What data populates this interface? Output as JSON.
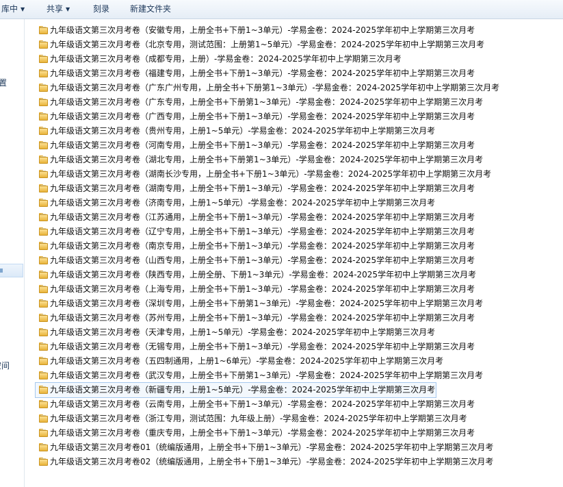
{
  "toolbar": {
    "library_label": "库中",
    "share_label": "共享",
    "burn_label": "刻录",
    "new_folder_label": "新建文件夹"
  },
  "nav": {
    "text_1": "置",
    "text_2": "空间"
  },
  "colors": {
    "toolbar_text": "#1e395b",
    "selection_border": "#a6c8ee",
    "folder_yellow": "#f2c75c"
  },
  "files": [
    "九年级语文第三次月考卷（安徽专用，上册全书+下册1~3单元）-学易金卷：2024-2025学年初中上学期第三次月考",
    "九年级语文第三次月考卷（北京专用，测试范围：上册第1~5单元）-学易金卷：2024-2025学年初中上学期第三次月考",
    "九年级语文第三次月考卷（成都专用，上册）-学易金卷：2024-2025学年初中上学期第三次月考",
    "九年级语文第三次月考卷（福建专用，上册全书+下册1~3单元）-学易金卷：2024-2025学年初中上学期第三次月考",
    "九年级语文第三次月考卷（广东广州专用，上册全书+下册第1~3单元）-学易金卷：2024-2025学年初中上学期第三次月考",
    "九年级语文第三次月考卷（广东专用，上册全书+下册第1~3单元）-学易金卷：2024-2025学年初中上学期第三次月考",
    "九年级语文第三次月考卷（广西专用，上册全书+下册1~3单元）-学易金卷：2024-2025学年初中上学期第三次月考",
    "九年级语文第三次月考卷（贵州专用，上册1~5单元）-学易金卷：2024-2025学年初中上学期第三次月考",
    "九年级语文第三次月考卷（河南专用，上册全书+下册1~3单元）-学易金卷：2024-2025学年初中上学期第三次月考",
    "九年级语文第三次月考卷（湖北专用，上册全书+下册第1~3单元）-学易金卷：2024-2025学年初中上学期第三次月考",
    "九年级语文第三次月考卷（湖南长沙专用，上册全书+下册1~3单元）-学易金卷：2024-2025学年初中上学期第三次月考",
    "九年级语文第三次月考卷（湖南专用，上册全书+下册1~3单元）-学易金卷：2024-2025学年初中上学期第三次月考",
    "九年级语文第三次月考卷（济南专用，上册1~5单元）-学易金卷：2024-2025学年初中上学期第三次月考",
    "九年级语文第三次月考卷（江苏通用，上册全书+下册1~3单元）-学易金卷：2024-2025学年初中上学期第三次月考",
    "九年级语文第三次月考卷（辽宁专用，上册全书+下册1~3单元）-学易金卷：2024-2025学年初中上学期第三次月考",
    "九年级语文第三次月考卷（南京专用，上册全书+下册1~3单元）-学易金卷：2024-2025学年初中上学期第三次月考",
    "九年级语文第三次月考卷（山西专用，上册全书+下册1~3单元）-学易金卷：2024-2025学年初中上学期第三次月考",
    "九年级语文第三次月考卷（陕西专用，上册全册、下册1~3单元）-学易金卷：2024-2025学年初中上学期第三次月考",
    "九年级语文第三次月考卷（上海专用，上册全书+下册1~3单元）-学易金卷：2024-2025学年初中上学期第三次月考",
    "九年级语文第三次月考卷（深圳专用，上册全书+下册第1~3单元）-学易金卷：2024-2025学年初中上学期第三次月考",
    "九年级语文第三次月考卷（苏州专用，上册全书+下册1~3单元）-学易金卷：2024-2025学年初中上学期第三次月考",
    "九年级语文第三次月考卷（天津专用，上册1~5单元）-学易金卷：2024-2025学年初中上学期第三次月考",
    "九年级语文第三次月考卷（无锡专用，上册全书+下册1~3单元）-学易金卷：2024-2025学年初中上学期第三次月考",
    "九年级语文第三次月考卷（五四制通用，上册1~6单元）-学易金卷：2024-2025学年初中上学期第三次月考",
    "九年级语文第三次月考卷（武汉专用，上册全书+下册第1~3单元）-学易金卷：2024-2025学年初中上学期第三次月考",
    "九年级语文第三次月考卷（新疆专用，上册1~5单元）-学易金卷：2024-2025学年初中上学期第三次月考",
    "九年级语文第三次月考卷（云南专用，上册全书+下册1~3单元）-学易金卷：2024-2025学年初中上学期第三次月考",
    "九年级语文第三次月考卷（浙江专用，测试范围：九年级上册）-学易金卷：2024-2025学年初中上学期第三次月考",
    "九年级语文第三次月考卷（重庆专用，上册全书+下册1~3单元）-学易金卷：2024-2025学年初中上学期第三次月考",
    "九年级语文第三次月考卷01（统编版通用，上册全书+下册1~3单元）-学易金卷：2024-2025学年初中上学期第三次月考",
    "九年级语文第三次月考卷02（统编版通用，上册全书+下册1~3单元）-学易金卷：2024-2025学年初中上学期第三次月考"
  ],
  "selected_index": 25
}
